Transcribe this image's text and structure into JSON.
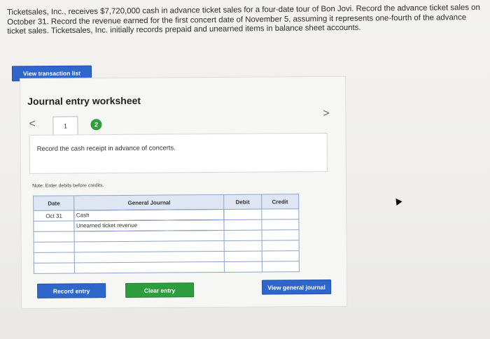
{
  "problem": {
    "line1": "Ticketsales, Inc., receives $7,720,000 cash in advance ticket sales for a four-date tour of Bon Jovi. Record the advance ticket sales on",
    "line2": "October 31. Record the revenue earned for the first concert date of November 5, assuming it represents one-fourth of the advance",
    "line3": "ticket sales. Ticketsales, Inc. initially records prepaid and unearned items in balance sheet accounts."
  },
  "view_transaction_list": "View transaction list",
  "worksheet": {
    "title": "Journal entry worksheet",
    "prev_arrow": "<",
    "next_arrow": ">",
    "tabs": [
      "1",
      "2"
    ],
    "instruction": "Record the cash receipt in advance of concerts.",
    "note": "Note: Enter debits before credits."
  },
  "table": {
    "headers": [
      "Date",
      "General Journal",
      "Debit",
      "Credit"
    ],
    "rows": [
      {
        "date": "Oct 31",
        "account": "Cash",
        "debit": "",
        "credit": ""
      },
      {
        "date": "",
        "account": "Unearned ticket revenue",
        "debit": "",
        "credit": ""
      },
      {
        "date": "",
        "account": "",
        "debit": "",
        "credit": ""
      },
      {
        "date": "",
        "account": "",
        "debit": "",
        "credit": ""
      },
      {
        "date": "",
        "account": "",
        "debit": "",
        "credit": ""
      },
      {
        "date": "",
        "account": "",
        "debit": "",
        "credit": ""
      }
    ]
  },
  "buttons": {
    "record_entry": "Record entry",
    "clear_entry": "Clear entry",
    "view_general_journal": "View general journal"
  },
  "colors": {
    "blue_button": "#2f66c9",
    "green_button": "#2e9d3e",
    "table_header": "#dde6f2"
  }
}
